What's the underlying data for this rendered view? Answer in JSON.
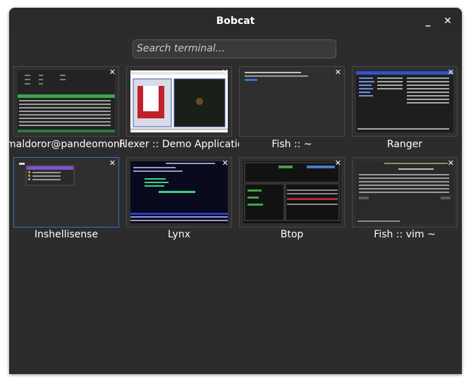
{
  "window": {
    "title": "Bobcat",
    "minimize_glyph": "_",
    "close_glyph": "✕"
  },
  "search": {
    "placeholder": "Search terminal..."
  },
  "tiles": [
    {
      "label": "maldoror@pandeomonium",
      "close": "✕"
    },
    {
      "label": "Flexer :: Demo Application",
      "close": "✕"
    },
    {
      "label": "Fish :: ~",
      "close": "✕"
    },
    {
      "label": "Ranger",
      "close": "✕"
    },
    {
      "label": "Inshellisense",
      "close": "✕"
    },
    {
      "label": "Lynx",
      "close": "✕"
    },
    {
      "label": "Btop",
      "close": "✕"
    },
    {
      "label": "Fish :: vim ~",
      "close": "✕"
    }
  ],
  "colors": {
    "window_bg": "#2c2c2c",
    "tile_bg": "#2f2f2f",
    "selected_border": "#3b6fd1"
  }
}
